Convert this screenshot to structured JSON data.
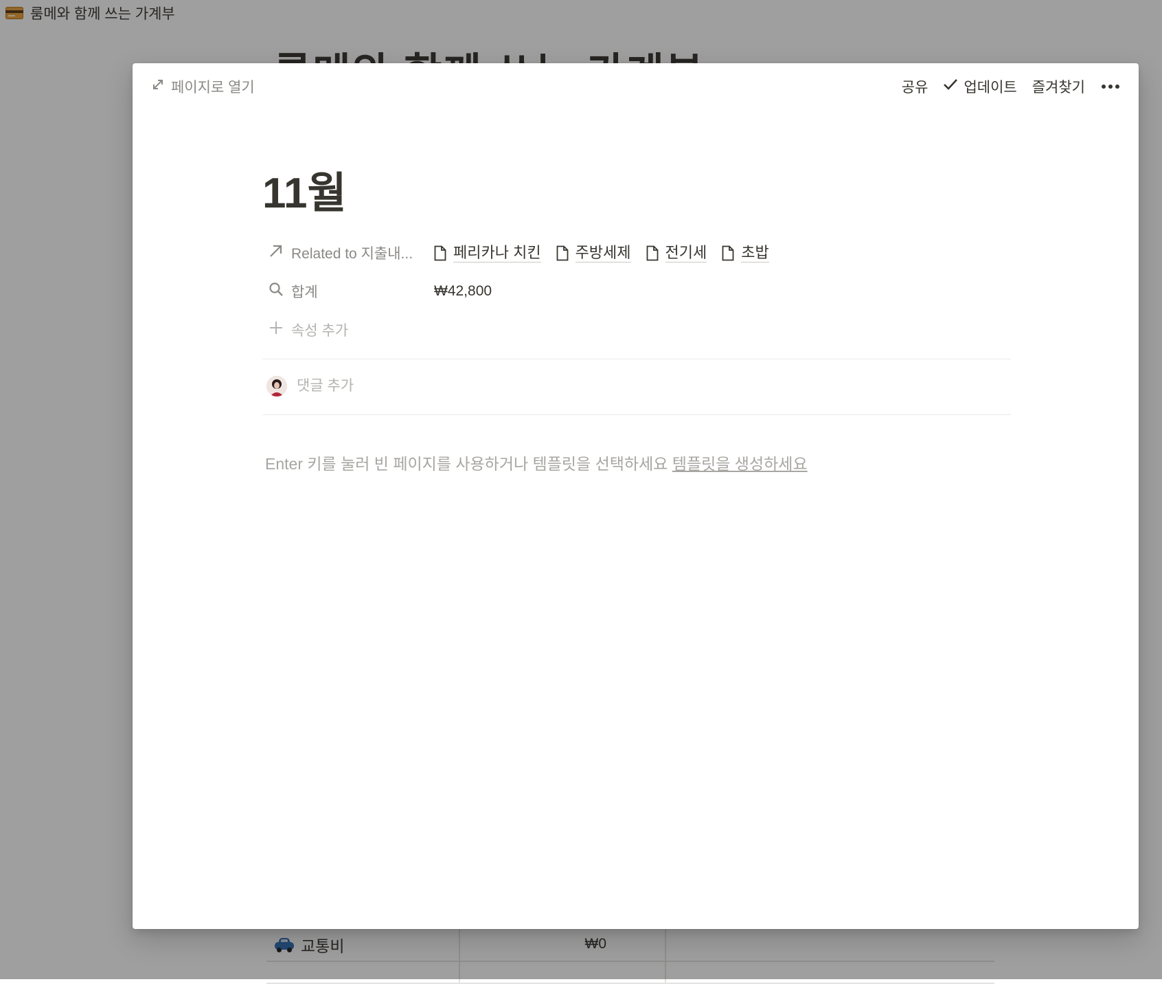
{
  "background": {
    "breadcrumb": "룸메와 함께 쓰는 가계부",
    "page_title": "룸메와 함께 쓰는 가계부",
    "rows": [
      {
        "name": "교통비",
        "value": "₩0"
      }
    ]
  },
  "modal": {
    "open_as_page": "페이지로 열기",
    "share": "공유",
    "updates": "업데이트",
    "favorite": "즐겨찾기",
    "title": "11월",
    "properties": [
      {
        "label": "Related to 지출내...",
        "icon": "arrow-up-right-icon",
        "relations": [
          "페리카나 치킨",
          "주방세제",
          "전기세",
          "초밥"
        ]
      },
      {
        "label": "합계",
        "icon": "search-icon",
        "value": "₩42,800"
      }
    ],
    "add_property": "속성 추가",
    "comment_placeholder": "댓글 추가",
    "empty_hint": "Enter 키를 눌러 빈 페이지를 사용하거나 템플릿을 선택하세요",
    "create_template": "템플릿을 생성하세요"
  },
  "colors": {
    "text": "#37352f",
    "muted": "#8a8985",
    "placeholder": "#b4b3b0",
    "overlay": "rgba(15,15,15,0.40)"
  }
}
